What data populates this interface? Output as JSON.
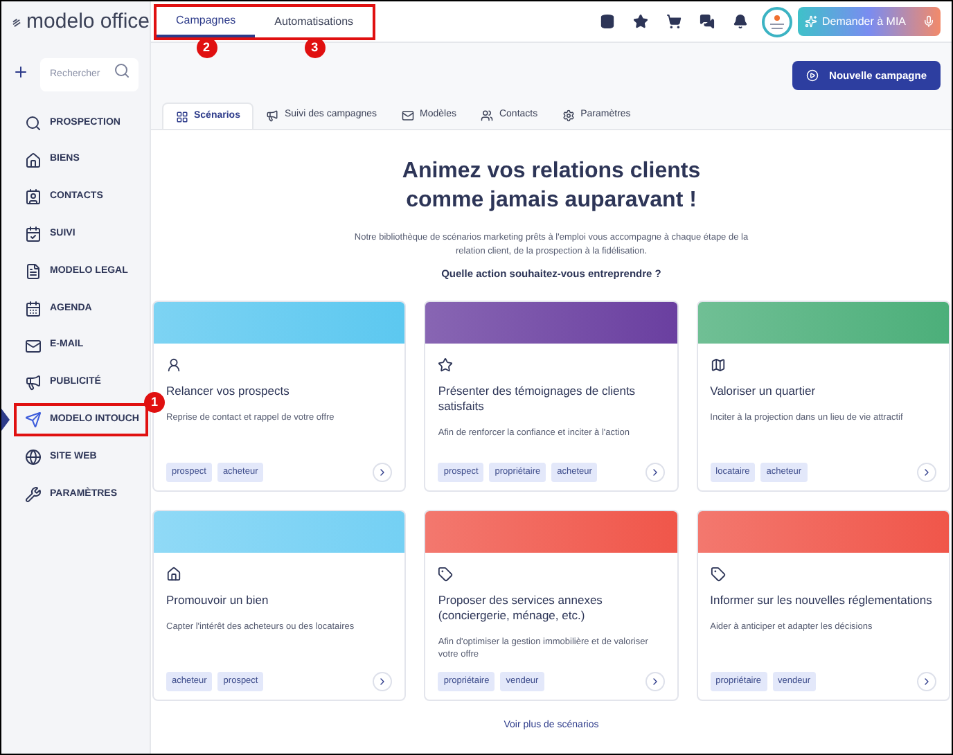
{
  "logo": {
    "text": "modelo office"
  },
  "top_tabs": {
    "highlighted": true,
    "items": [
      {
        "label": "Campagnes",
        "selected": true,
        "callout": "2"
      },
      {
        "label": "Automatisations",
        "selected": false,
        "callout": "3"
      }
    ]
  },
  "mia_button": {
    "label": "Demander à MIA"
  },
  "sidebar": {
    "search": {
      "placeholder": "Rechercher"
    },
    "items": [
      {
        "label": "PROSPECTION",
        "selected": false,
        "highlighted": false
      },
      {
        "label": "BIENS",
        "selected": false,
        "highlighted": false
      },
      {
        "label": "CONTACTS",
        "selected": false,
        "highlighted": false
      },
      {
        "label": "SUIVI",
        "selected": false,
        "highlighted": false
      },
      {
        "label": "MODELO LEGAL",
        "selected": false,
        "highlighted": false
      },
      {
        "label": "AGENDA",
        "selected": false,
        "highlighted": false
      },
      {
        "label": "E-MAIL",
        "selected": false,
        "highlighted": false
      },
      {
        "label": "PUBLICITÉ",
        "selected": false,
        "highlighted": false
      },
      {
        "label": "MODELO INTOUCH",
        "selected": true,
        "highlighted": true,
        "callout": "1"
      },
      {
        "label": "SITE WEB",
        "selected": false,
        "highlighted": false
      },
      {
        "label": "PARAMÈTRES",
        "selected": false,
        "highlighted": false
      }
    ]
  },
  "new_campaign_button": {
    "label": "Nouvelle campagne"
  },
  "tabs": [
    {
      "label": "Scénarios",
      "selected": true
    },
    {
      "label": "Suivi des campagnes",
      "selected": false
    },
    {
      "label": "Modèles",
      "selected": false
    },
    {
      "label": "Contacts",
      "selected": false
    },
    {
      "label": "Paramètres",
      "selected": false
    }
  ],
  "hero": {
    "title_line_1": "Animez vos relations clients",
    "title_line_2": "comme jamais auparavant !",
    "description": "Notre bibliothèque de scénarios marketing prêts à l'emploi vous accompagne à chaque étape de la relation client, de la prospection à la fidélisation.",
    "question": "Quelle action souhaitez-vous entreprendre ?"
  },
  "cards": [
    {
      "title": "Relancer vos prospects",
      "description": "Reprise de contact et rappel de votre offre",
      "color": "#5cc8f0",
      "tags": [
        "prospect",
        "acheteur"
      ]
    },
    {
      "title": "Présenter des témoignages de clients satisfaits",
      "description": "Afin de renforcer la confiance et inciter à l'action",
      "color": "#6a3fa0",
      "tags": [
        "prospect",
        "propriétaire",
        "acheteur"
      ]
    },
    {
      "title": "Valoriser un quartier",
      "description": "Inciter à la projection dans un lieu de vie attractif",
      "color": "#4caf7a",
      "tags": [
        "locataire",
        "acheteur"
      ]
    },
    {
      "title": "Promouvoir un bien",
      "description": "Capter l'intérêt des acheteurs ou des locataires",
      "color": "#74d0f4",
      "tags": [
        "acheteur",
        "prospect"
      ]
    },
    {
      "title": "Proposer des services annexes (conciergerie, ménage, etc.)",
      "description": "Afin d'optimiser la gestion immobilière et de valoriser votre offre",
      "color": "#f0564a",
      "tags": [
        "propriétaire",
        "vendeur"
      ]
    },
    {
      "title": "Informer sur les nouvelles réglementations",
      "description": "Aider à anticiper et adapter les décisions",
      "color": "#f0564a",
      "tags": [
        "propriétaire",
        "vendeur"
      ]
    }
  ],
  "more_link": {
    "label": "Voir plus de scénarios"
  }
}
